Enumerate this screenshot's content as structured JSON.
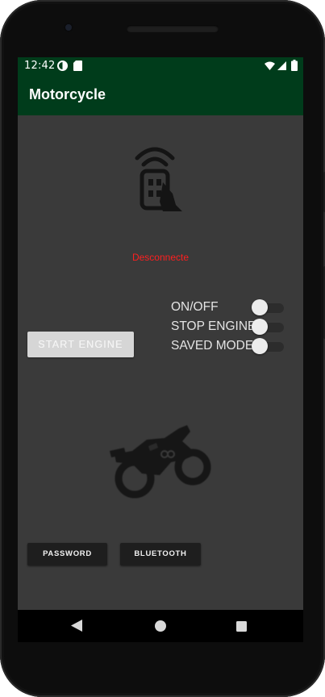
{
  "status_bar": {
    "time": "12:42",
    "icons": [
      "data-saver-icon",
      "sd-card-icon",
      "wifi-icon",
      "signal-icon",
      "battery-icon"
    ]
  },
  "app_bar": {
    "title": "Motorcycle",
    "color": "#003c1b"
  },
  "connection": {
    "status_text": "Desconnecte",
    "status_color": "#ff1f1f"
  },
  "controls": {
    "start_engine_label": "START ENGINE",
    "switches": [
      {
        "label": "ON/OFF",
        "checked": false
      },
      {
        "label": "STOP ENGINE",
        "checked": false
      },
      {
        "label": "SAVED MODE",
        "checked": false
      }
    ]
  },
  "bottom_buttons": {
    "password_label": "PASSWORD",
    "bluetooth_label": "BLUETOOTH"
  },
  "icons": {
    "remote": "remote-control-icon",
    "motorcycle": "motorcycle-icon"
  },
  "nav_bar": {
    "buttons": [
      "back-icon",
      "home-icon",
      "recents-icon"
    ]
  }
}
